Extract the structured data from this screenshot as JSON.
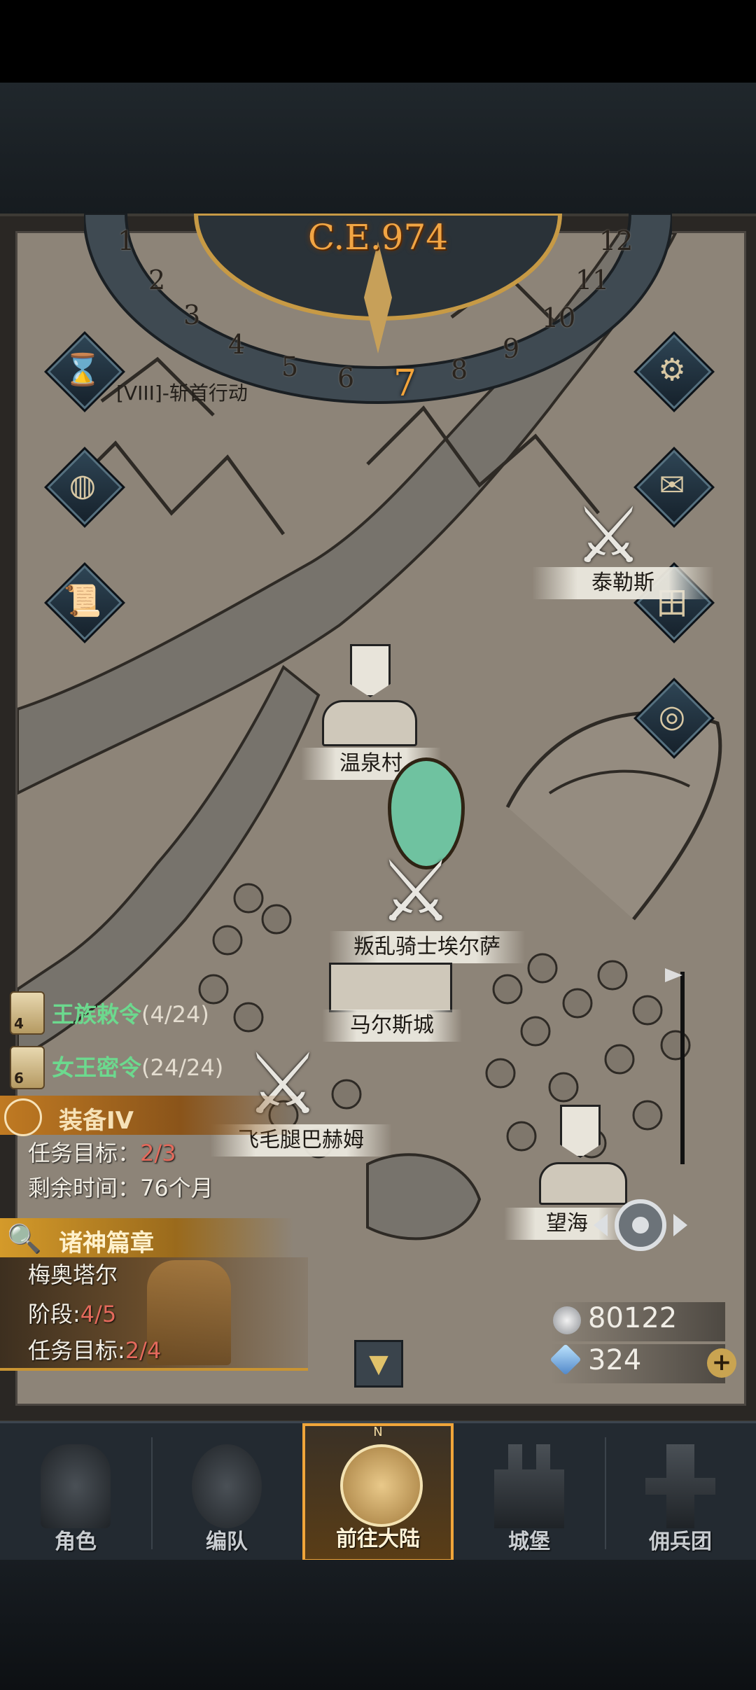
{
  "calendar": {
    "year": "C.E.974",
    "months": [
      "1",
      "2",
      "3",
      "4",
      "5",
      "6",
      "7",
      "8",
      "9",
      "10",
      "11",
      "12"
    ],
    "current_month": "7"
  },
  "quest_top": "[VIII]-斩首行动",
  "locations": {
    "taile": "泰勒斯",
    "wenquan": "温泉村",
    "rebel": "叛乱骑士埃尔萨",
    "maers": "马尔斯城",
    "feimao": "飞毛腿巴赫姆",
    "wanghai": "望海"
  },
  "edicts": [
    {
      "badge": "4",
      "name": "王族敕令",
      "count": "(4/24)"
    },
    {
      "badge": "6",
      "name": "女王密令",
      "count": "(24/24)"
    }
  ],
  "equip_quest": {
    "title": "装备IV",
    "target_label": "任务目标：",
    "target_value": "2/3",
    "time_label": "剩余时间：",
    "time_value": "76个月"
  },
  "gods_quest": {
    "title": "诸神篇章",
    "hero": "梅奥塔尔",
    "stage_label": "阶段:",
    "stage_value": "4/5",
    "target_label": "任务目标:",
    "target_value": "2/4"
  },
  "currency": {
    "silver": "80122",
    "crystal": "324"
  },
  "nav": [
    {
      "label": "角色"
    },
    {
      "label": "编队"
    },
    {
      "label": "前往大陆"
    },
    {
      "label": "城堡"
    },
    {
      "label": "佣兵团"
    }
  ],
  "compass_letter": "N",
  "colors": {
    "accent_orange": "#f0a53a",
    "green_text": "#6cd98e",
    "red_value": "#e46a5c"
  }
}
